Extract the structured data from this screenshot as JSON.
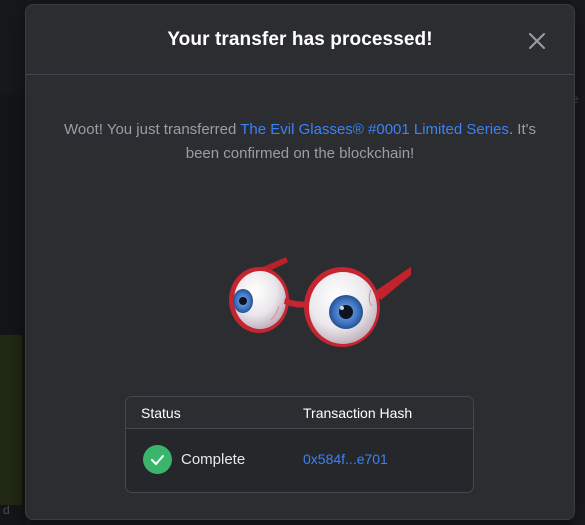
{
  "background": {
    "right_glyph": "e",
    "bottom_left_glyph": "d"
  },
  "modal": {
    "title": "Your transfer has processed!",
    "close_icon": "close-icon",
    "message": {
      "prefix": "Woot! You just transferred ",
      "item_link": "The Evil Glasses® #0001 Limited Series",
      "suffix": ". It's been confirmed on the blockchain!"
    },
    "image_icon": "evil-eyeball-glasses-image"
  },
  "table": {
    "headers": [
      "Status",
      "Transaction Hash"
    ],
    "row": {
      "status": "Complete",
      "status_icon": "checkmark-icon",
      "hash": "0x584f...e701"
    }
  },
  "colors": {
    "accent": "#3b82f6",
    "success": "#3ab56b",
    "modal_bg": "#2b2d31",
    "title": "#ffffff"
  }
}
